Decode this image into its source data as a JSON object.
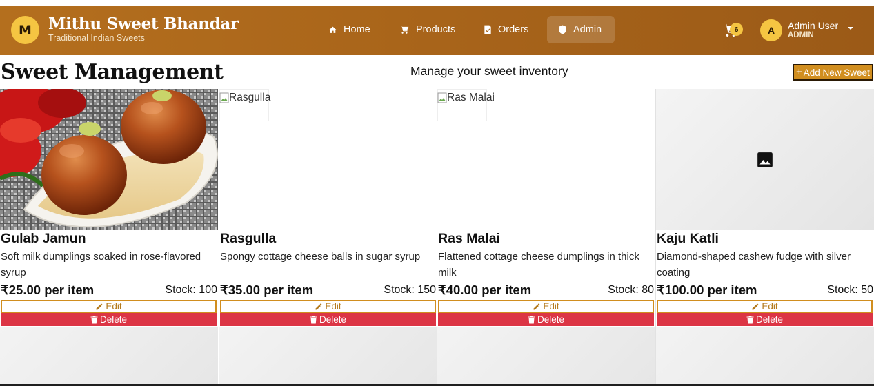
{
  "brand": {
    "logo_letter": "M",
    "title": "Mithu Sweet Bhandar",
    "subtitle": "Traditional Indian Sweets",
    "color": "#b46f1e",
    "accent": "#f5c542"
  },
  "nav": {
    "items": [
      {
        "label": "Home",
        "icon": "home-icon"
      },
      {
        "label": "Products",
        "icon": "cart-icon"
      },
      {
        "label": "Orders",
        "icon": "receipt-icon"
      },
      {
        "label": "Admin",
        "icon": "shield-icon",
        "active": true
      }
    ]
  },
  "cart": {
    "count": "6",
    "icon": "cart-icon"
  },
  "user": {
    "avatar_letter": "A",
    "name": "Admin User",
    "role": "ADMIN"
  },
  "page": {
    "title": "Sweet Management",
    "subtitle": "Manage your sweet inventory",
    "add_button": "Add New Sweet"
  },
  "sweets": [
    {
      "name": "Gulab Jamun",
      "description": "Soft milk dumplings soaked in rose-flavored syrup",
      "price": "₹25.00 per item",
      "stock": "Stock: 100",
      "image": "photo",
      "image_alt": "",
      "edit": "Edit",
      "delete": "Delete"
    },
    {
      "name": "Rasgulla",
      "description": "Spongy cottage cheese balls in sugar syrup",
      "price": "₹35.00 per item",
      "stock": "Stock: 150",
      "image": "broken",
      "image_alt": "Rasgulla",
      "edit": "Edit",
      "delete": "Delete"
    },
    {
      "name": "Ras Malai",
      "description": "Flattened cottage cheese dumplings in thick milk",
      "price": "₹40.00 per item",
      "stock": "Stock: 80",
      "image": "broken",
      "image_alt": "Ras Malai",
      "edit": "Edit",
      "delete": "Delete"
    },
    {
      "name": "Kaju Katli",
      "description": "Diamond-shaped cashew fudge with silver coating",
      "price": "₹100.00 per item",
      "stock": "Stock: 50",
      "image": "placeholder",
      "image_alt": "",
      "edit": "Edit",
      "delete": "Delete"
    }
  ],
  "colors": {
    "edit_border": "#d18e1f",
    "delete_bg": "#dc3545",
    "add_bg": "#d18e1f"
  }
}
